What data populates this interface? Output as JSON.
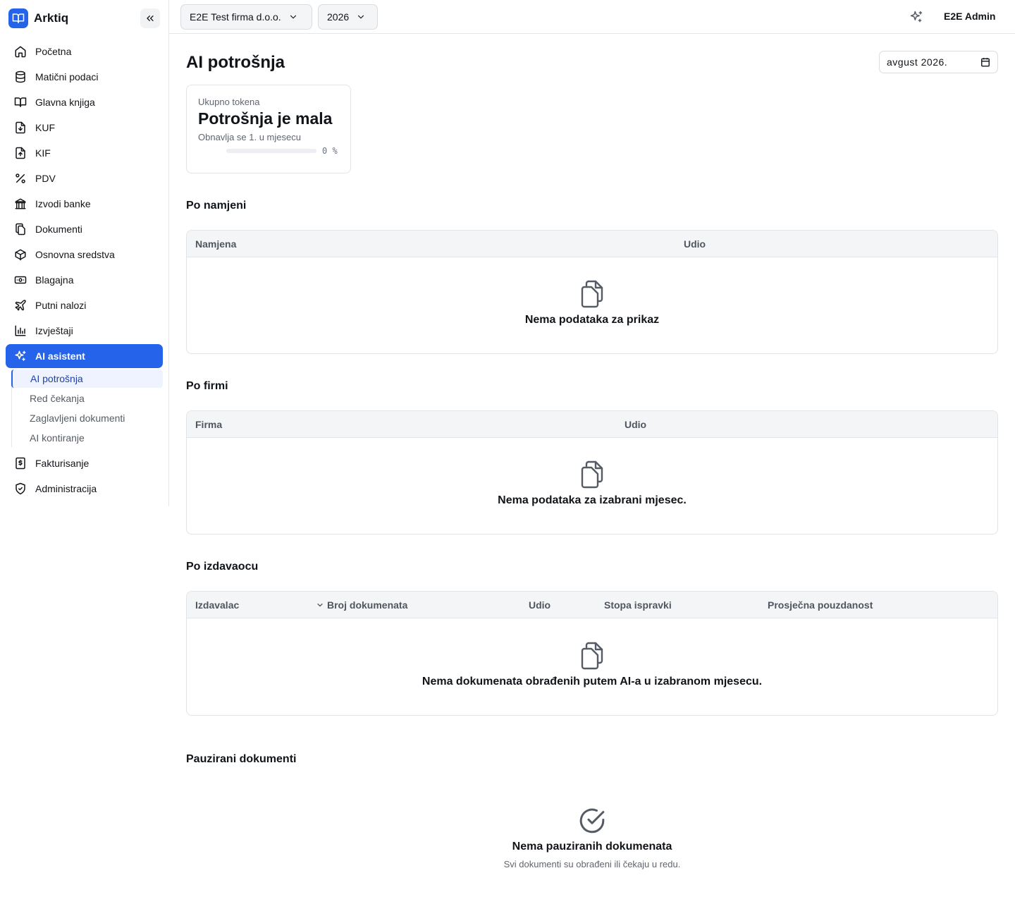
{
  "app": {
    "name": "Arktiq"
  },
  "sidebar": {
    "items": [
      {
        "label": "Početna",
        "icon": "home-icon"
      },
      {
        "label": "Matični podaci",
        "icon": "database-icon"
      },
      {
        "label": "Glavna knjiga",
        "icon": "book-icon"
      },
      {
        "label": "KUF",
        "icon": "file-download-icon"
      },
      {
        "label": "KIF",
        "icon": "file-upload-icon"
      },
      {
        "label": "PDV",
        "icon": "percent-icon"
      },
      {
        "label": "Izvodi banke",
        "icon": "bank-icon"
      },
      {
        "label": "Dokumenti",
        "icon": "documents-icon"
      },
      {
        "label": "Osnovna sredstva",
        "icon": "box-icon"
      },
      {
        "label": "Blagajna",
        "icon": "cash-icon"
      },
      {
        "label": "Putni nalozi",
        "icon": "plane-icon"
      },
      {
        "label": "Izvještaji",
        "icon": "bar-chart-icon"
      },
      {
        "label": "AI asistent",
        "icon": "sparkles-icon"
      }
    ],
    "sub_items": [
      "AI potrošnja",
      "Red čekanja",
      "Zaglavljeni dokumenti",
      "AI kontiranje"
    ],
    "bottom_items": [
      {
        "label": "Fakturisanje",
        "icon": "invoice-icon"
      },
      {
        "label": "Administracija",
        "icon": "shield-icon"
      }
    ]
  },
  "topbar": {
    "company": "E2E Test firma d.o.o.",
    "year": "2026",
    "user": "E2E Admin"
  },
  "page": {
    "title": "AI potrošnja",
    "month": "avgust 2026."
  },
  "usage_card": {
    "label": "Ukupno tokena",
    "value": "Potrošnja je mala",
    "sub": "Obnavlja se 1. u mjesecu",
    "progress_text": "0 %",
    "progress_percent": 0
  },
  "by_purpose": {
    "title": "Po namjeni",
    "columns": [
      "Namjena",
      "Udio"
    ],
    "empty": "Nema podataka za prikaz"
  },
  "by_company": {
    "title": "Po firmi",
    "columns": [
      "Firma",
      "Udio"
    ],
    "empty": "Nema podataka za izabrani mjesec."
  },
  "by_issuer": {
    "title": "Po izdavaocu",
    "columns": [
      "Izdavalac",
      "Broj dokumenata",
      "Udio",
      "Stopa ispravki",
      "Prosječna pouzdanost"
    ],
    "empty": "Nema dokumenata obrađenih putem AI-a u izabranom mjesecu."
  },
  "paused": {
    "title": "Pauzirani dokumenti",
    "empty": "Nema pauziranih dokumenata",
    "empty_sub": "Svi dokumenti su obrađeni ili čekaju u redu."
  },
  "colors": {
    "accent": "#2563eb",
    "border": "#e1e4e8"
  }
}
